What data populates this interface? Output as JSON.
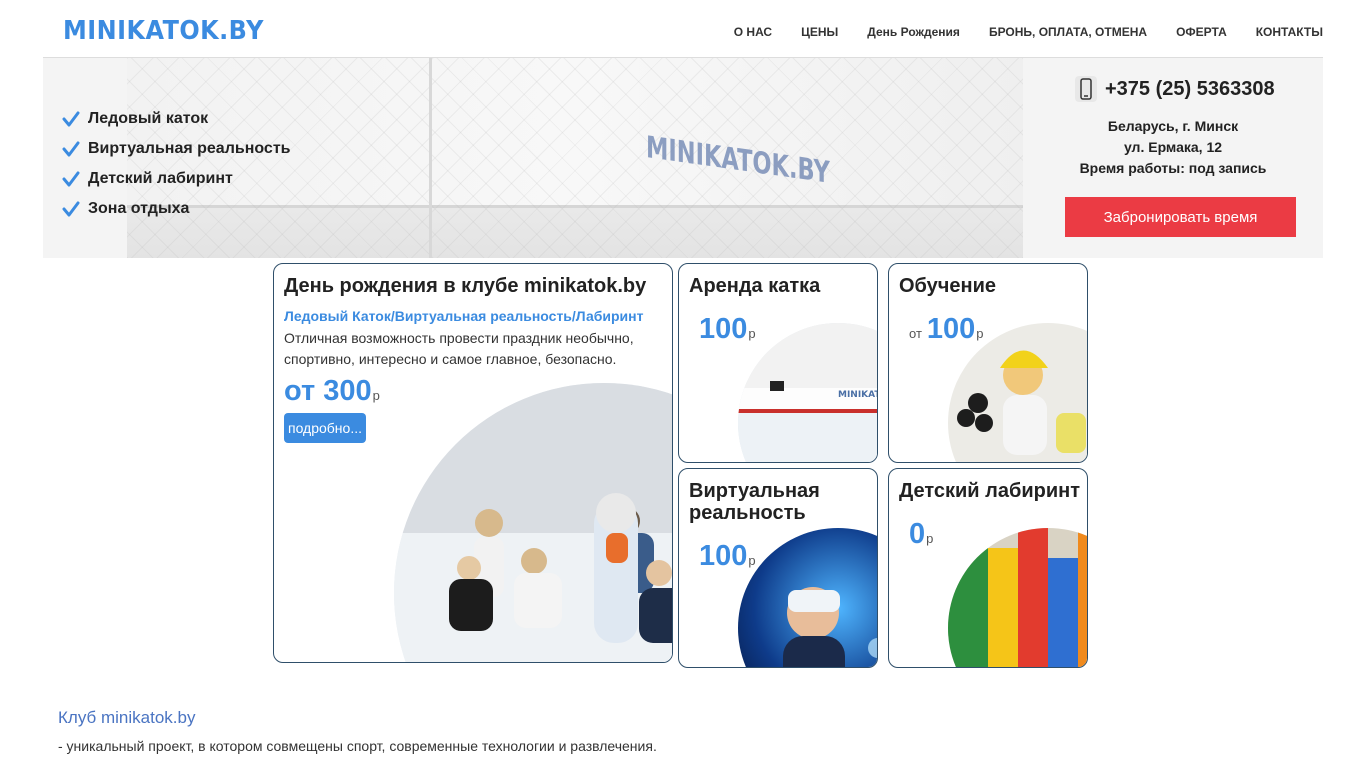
{
  "header": {
    "logo": "MINIKATOK.BY",
    "nav": [
      "О НАС",
      "ЦЕНЫ",
      "День Рождения",
      "БРОНЬ, ОПЛАТА, ОТМЕНА",
      "ОФЕРТА",
      "КОНТАКТЫ"
    ]
  },
  "hero": {
    "features": [
      "Ледовый каток",
      "Виртуальная реальность",
      "Детский лабиринт",
      "Зона отдыха"
    ],
    "watermark": "MINIKATOK.BY"
  },
  "contact": {
    "phone": "+375 (25) 5363308",
    "address_line1": "Беларусь, г. Минск",
    "address_line2": "ул. Ермака, 12",
    "hours": "Время работы: под запись",
    "book_button": "Забронировать время"
  },
  "cards": {
    "birthday": {
      "title": "День рождения в клубе minikatok.by",
      "subtitle": "Ледовый Каток/Виртуальная реальность/Лабиринт",
      "description": "Отличная возможность провести праздник необычно, спортивно, интересно и самое главное, безопасно.",
      "price_prefix": "от",
      "price": "300",
      "currency": "р",
      "more_button": "подробно..."
    },
    "rink": {
      "title": "Аренда катка",
      "price": "100",
      "currency": "р"
    },
    "training": {
      "title": "Обучение",
      "price_prefix": "от",
      "price": "100",
      "currency": "р"
    },
    "vr": {
      "title": "Виртуальная реальность",
      "price": "100",
      "currency": "р"
    },
    "maze": {
      "title": "Детский лабиринт",
      "price": "0",
      "currency": "р"
    }
  },
  "club": {
    "title": "Клуб minikatok.by",
    "description": "- уникальный проект, в котором совмещены спорт, современные технологии и развлечения."
  },
  "colors": {
    "accent_blue": "#3b8be0",
    "book_red": "#eb3b44",
    "card_border": "#2f4f6a"
  }
}
